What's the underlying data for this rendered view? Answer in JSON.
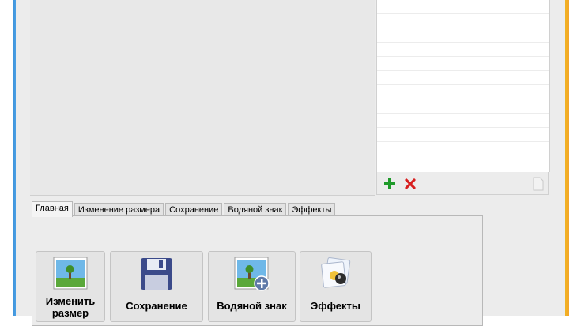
{
  "tabs": [
    {
      "label": "Главная",
      "active": true
    },
    {
      "label": "Изменение размера",
      "active": false
    },
    {
      "label": "Сохранение",
      "active": false
    },
    {
      "label": "Водяной знак",
      "active": false
    },
    {
      "label": "Эффекты",
      "active": false
    }
  ],
  "tools": [
    {
      "label": "Изменить размер",
      "icon": "resize-image-icon"
    },
    {
      "label": "Сохранение",
      "icon": "floppy-disk-icon"
    },
    {
      "label": "Водяной знак",
      "icon": "watermark-image-icon"
    },
    {
      "label": "Эффекты",
      "icon": "effects-icon"
    }
  ],
  "list_actions": {
    "add": "add-icon",
    "remove": "remove-icon",
    "page": "page-icon"
  },
  "colors": {
    "add": "#1f9a2a",
    "remove": "#d81f1f",
    "window_left_accent": "#3d8fd6",
    "window_right_accent": "#f0b323"
  }
}
